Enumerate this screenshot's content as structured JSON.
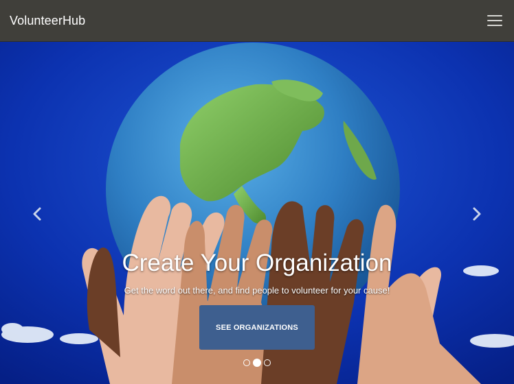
{
  "navbar": {
    "brand": "VolunteerHub",
    "menu_icon": "hamburger-menu-icon"
  },
  "carousel": {
    "title": "Create Your Organization",
    "subtitle": "Get the word out there, and find people to volunteer for your cause!",
    "cta_label": "SEE ORGANIZATIONS",
    "prev_icon": "chevron-left-icon",
    "next_icon": "chevron-right-icon",
    "slide_count": 3,
    "active_slide": 2
  },
  "colors": {
    "navbar": "#403f3a",
    "cta": "#3e5f8f",
    "sky": "#0a2fa8"
  }
}
